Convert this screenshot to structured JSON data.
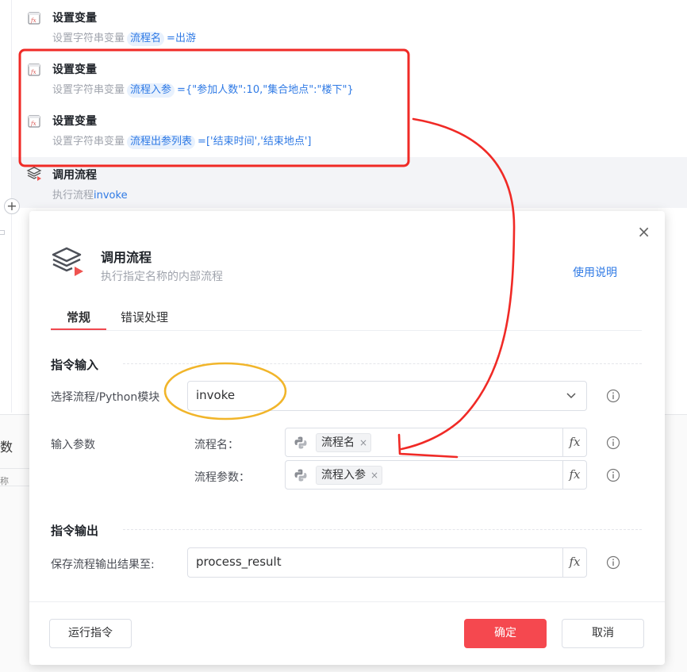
{
  "workflow": {
    "items": [
      {
        "title": "设置变量",
        "desc_prefix": "设置字符串变量",
        "var": "流程名",
        "eq": "=",
        "value": "出游"
      },
      {
        "title": "设置变量",
        "desc_prefix": "设置字符串变量",
        "var": "流程入参",
        "eq": "=",
        "value": "{\"参加人数\":10,\"集合地点\":\"楼下\"}"
      },
      {
        "title": "设置变量",
        "desc_prefix": "设置字符串变量",
        "var": "流程出参列表",
        "eq": "=",
        "value": "['结束时间','结束地点']"
      },
      {
        "title": "调用流程",
        "desc_prefix": "执行流程",
        "value": "invoke"
      }
    ],
    "add_symbol": "+"
  },
  "background_pane": {
    "char_top": "数",
    "char_bottom": "称"
  },
  "icons": {
    "set_var": "fx-variable-icon",
    "call_flow": "layers-play-icon",
    "python": "python-icon",
    "info": "info-circle-icon",
    "close": "close-icon",
    "chevron": "chevron-down-icon"
  },
  "dialog": {
    "title": "调用流程",
    "subtitle": "执行指定名称的内部流程",
    "help_link": "使用说明",
    "close_symbol": "×",
    "tabs": [
      {
        "label": "常规",
        "active": true
      },
      {
        "label": "错误处理",
        "active": false
      }
    ],
    "input_section": {
      "title": "指令输入",
      "select_flow_label": "选择流程/Python模块",
      "select_flow_value": "invoke",
      "params_label": "输入参数",
      "params": [
        {
          "label": "流程名：",
          "tag": "流程名",
          "tag_close": "×"
        },
        {
          "label": "流程参数：",
          "tag": "流程入参",
          "tag_close": "×"
        }
      ],
      "fx_label": "fx"
    },
    "output_section": {
      "title": "指令输出",
      "save_label": "保存流程输出结果至:",
      "save_value": "process_result"
    },
    "buttons": {
      "run": "运行指令",
      "confirm": "确定",
      "cancel": "取消"
    }
  },
  "colors": {
    "accent": "#f5484f",
    "link": "#2f7ae5",
    "annotation_red": "#f02a26",
    "annotation_yellow": "#f1b52a"
  }
}
